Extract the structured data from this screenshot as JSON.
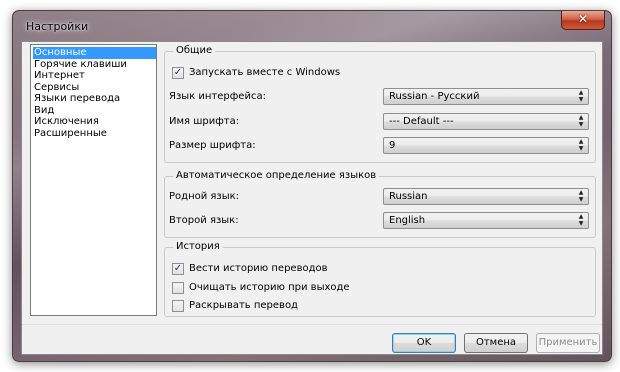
{
  "window": {
    "title": "Настройки"
  },
  "nav": {
    "items": [
      {
        "label": "Основные",
        "selected": true
      },
      {
        "label": "Горячие клавиши",
        "selected": false
      },
      {
        "label": "Интернет",
        "selected": false
      },
      {
        "label": "Сервисы",
        "selected": false
      },
      {
        "label": "Языки перевода",
        "selected": false
      },
      {
        "label": "Вид",
        "selected": false
      },
      {
        "label": "Исключения",
        "selected": false
      },
      {
        "label": "Расширенные",
        "selected": false
      }
    ]
  },
  "general": {
    "legend": "Общие",
    "autostart": {
      "label": "Запускать вместе с Windows",
      "checked": true
    },
    "interface_lang": {
      "label": "Язык интерфейса:",
      "value": "Russian - Русский"
    },
    "font_name": {
      "label": "Имя шрифта:",
      "value": "--- Default ---"
    },
    "font_size": {
      "label": "Размер шрифта:",
      "value": "9"
    }
  },
  "autodetect": {
    "legend": "Автоматическое определение языков",
    "native_lang": {
      "label": "Родной язык:",
      "value": "Russian"
    },
    "second_lang": {
      "label": "Второй язык:",
      "value": "English"
    }
  },
  "history": {
    "legend": "История",
    "keep": {
      "label": "Вести историю переводов",
      "checked": true
    },
    "clear_on_exit": {
      "label": "Очищать историю при выходе",
      "checked": false
    },
    "expand": {
      "label": "Раскрывать перевод",
      "checked": false
    }
  },
  "buttons": {
    "ok": "OK",
    "cancel": "Отмена",
    "apply": "Применить"
  },
  "icons": {
    "check": "✓",
    "close": "✕"
  }
}
